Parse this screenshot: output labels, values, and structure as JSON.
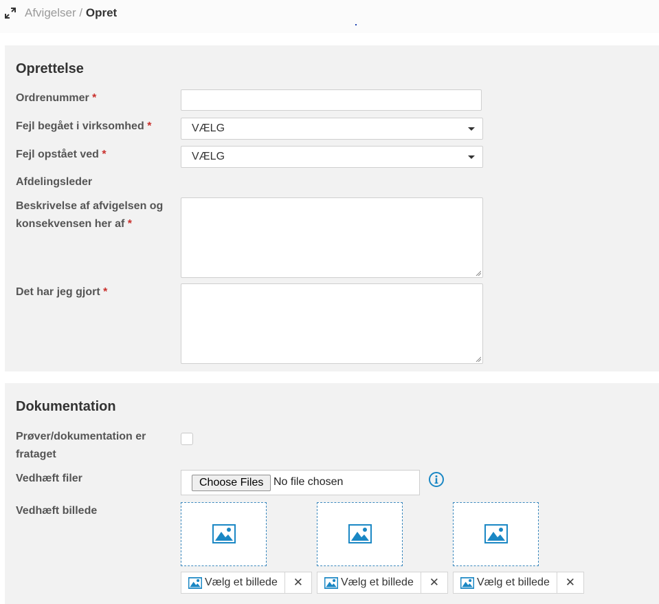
{
  "breadcrumb": {
    "parent": "Afvigelser",
    "separator": "/",
    "current": "Opret"
  },
  "oprettelse": {
    "title": "Oprettelse",
    "fields": {
      "ordrenummer": {
        "label": "Ordrenummer",
        "value": ""
      },
      "fejl_begaaet": {
        "label": "Fejl begået i virksomhed",
        "value": "VÆLG"
      },
      "fejl_opstaaet": {
        "label": "Fejl opstået ved",
        "value": "VÆLG"
      },
      "afdelingsleder": {
        "label": "Afdelingsleder"
      },
      "beskrivelse": {
        "label_line1": "Beskrivelse af afvigelsen og",
        "label_line2": "konsekvensen her af",
        "value": ""
      },
      "gjort": {
        "label": "Det har jeg gjort",
        "value": ""
      }
    },
    "required_mark": "*"
  },
  "dokumentation": {
    "title": "Dokumentation",
    "prover": {
      "label_line1": "Prøver/dokumentation er",
      "label_line2": "frataget",
      "checked": false
    },
    "files": {
      "label": "Vedhæft filer",
      "button": "Choose Files",
      "status": "No file chosen"
    },
    "images": {
      "label": "Vedhæft billede",
      "slots": [
        {
          "button": "Vælg et billede",
          "remove": "✕"
        },
        {
          "button": "Vælg et billede",
          "remove": "✕"
        },
        {
          "button": "Vælg et billede",
          "remove": "✕"
        }
      ]
    }
  },
  "colors": {
    "accent": "#1a87c4",
    "required": "#c9302c",
    "panel": "#f2f2f2"
  },
  "icons": [
    "expand-icon",
    "info-icon",
    "image-icon",
    "close-icon",
    "chevron-down-icon"
  ]
}
